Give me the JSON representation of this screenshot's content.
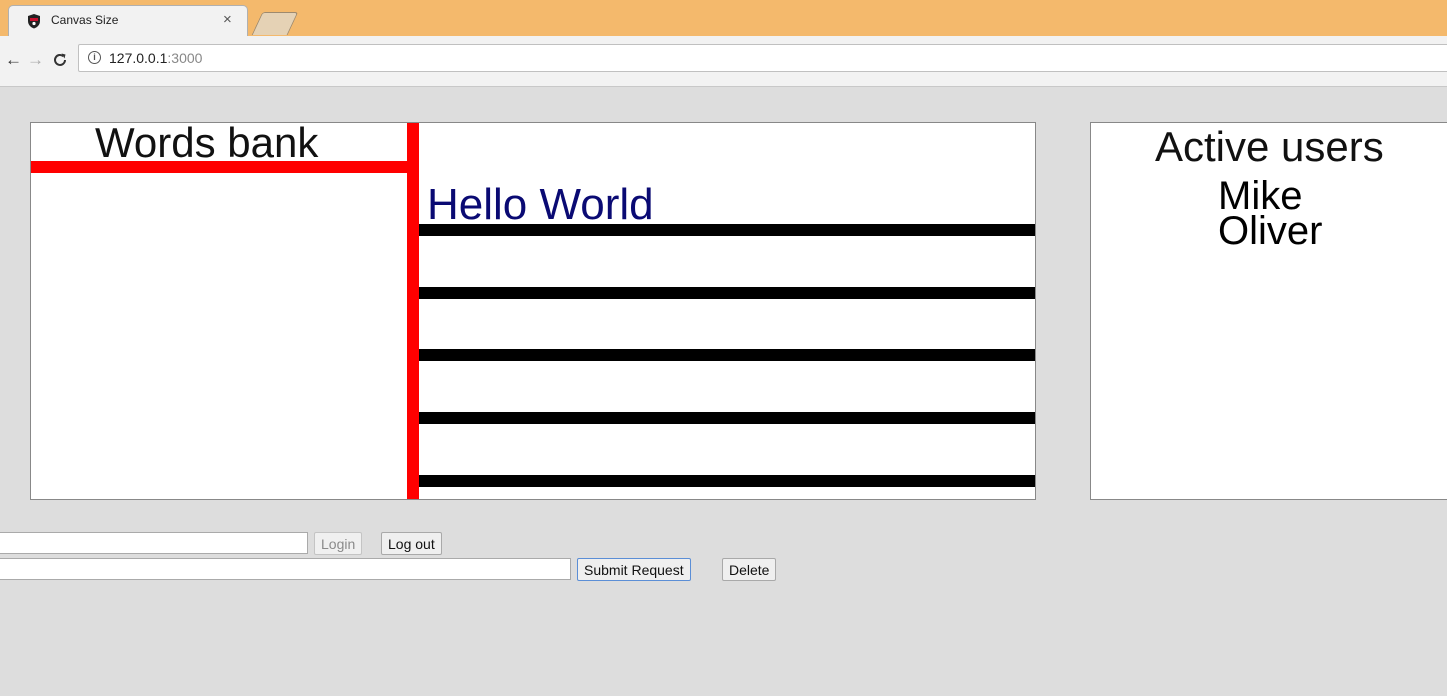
{
  "browser": {
    "tab_title": "Canvas Size",
    "tab_close": "×",
    "url_host": "127.0.0.1",
    "url_port": ":3000",
    "info_icon": "i"
  },
  "canvas": {
    "words_bank_title": "Words bank",
    "hello_text": "Hello  World",
    "line_colors": {
      "accent": "#ff0000",
      "lines": "#000000",
      "text": "#0a0a73"
    }
  },
  "active_users": {
    "title": "Active users",
    "users": [
      "Mike",
      "Oliver"
    ]
  },
  "login_form": {
    "username_value": "",
    "login_label": "Login",
    "logout_label": "Log out"
  },
  "request_form": {
    "request_value": "",
    "submit_label": "Submit Request",
    "delete_label": "Delete"
  }
}
